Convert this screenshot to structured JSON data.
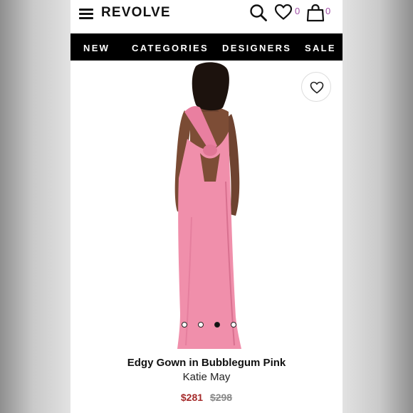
{
  "header": {
    "logo": "REVOLVE",
    "wishlist_count": "0",
    "bag_count": "0"
  },
  "nav": {
    "items": [
      "NEW",
      "CATEGORIES",
      "DESIGNERS",
      "SALE"
    ]
  },
  "carousel": {
    "slide_count": 4,
    "active_index": 2
  },
  "product": {
    "name": "Edgy Gown in Bubblegum Pink",
    "brand": "Katie May",
    "sale_price": "$281",
    "original_price": "$298",
    "dress_color": "#f08fab"
  },
  "colors": {
    "nav_bg": "#000000",
    "count_accent": "#a14fa6",
    "sale_price": "#a52a2a"
  }
}
